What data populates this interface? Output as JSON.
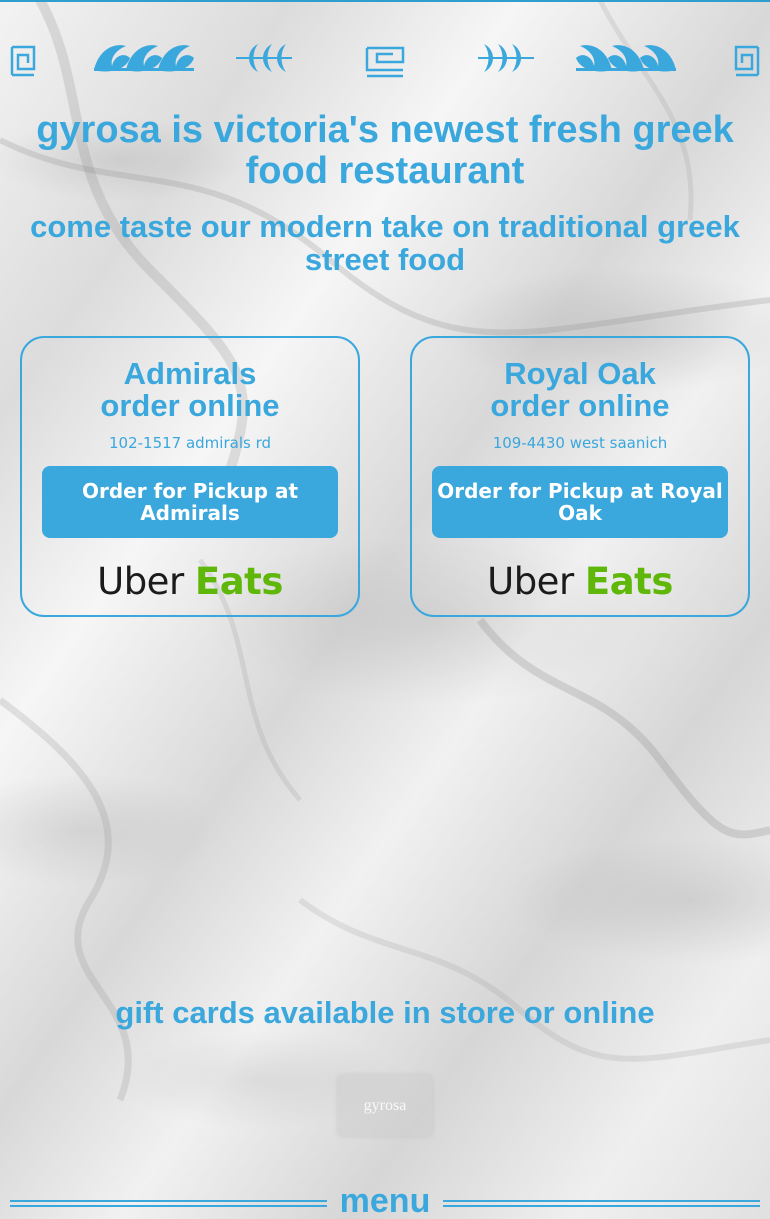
{
  "colors": {
    "accent": "#3aa7dd",
    "button_text": "#ffffff",
    "uber_black": "#1b1b1b",
    "uber_green": "#5fb709"
  },
  "header": {
    "ornament_icons": [
      "greek-key-icon",
      "wave-scroll-icon",
      "arrows-left-icon",
      "greek-key-icon",
      "arrows-right-icon",
      "wave-scroll-icon",
      "greek-key-icon"
    ]
  },
  "hero": {
    "headline": "gyrosa is victoria's newest fresh greek food restaurant",
    "subline": "come taste our modern take on traditional greek street food"
  },
  "locations": [
    {
      "name": "Admirals",
      "order_label": "order online",
      "address": "102-1517 admirals rd",
      "pickup_button": "Order for Pickup at Admirals",
      "uber_word": "Uber",
      "eats_word": "Eats"
    },
    {
      "name": "Royal Oak",
      "order_label": "order online",
      "address": "109-4430 west saanich",
      "pickup_button": "Order for Pickup at Royal Oak",
      "uber_word": "Uber",
      "eats_word": "Eats"
    }
  ],
  "gift": {
    "text": "gift cards available in store or online",
    "card_brand": "gyrosa"
  },
  "menu": {
    "heading": "menu"
  }
}
